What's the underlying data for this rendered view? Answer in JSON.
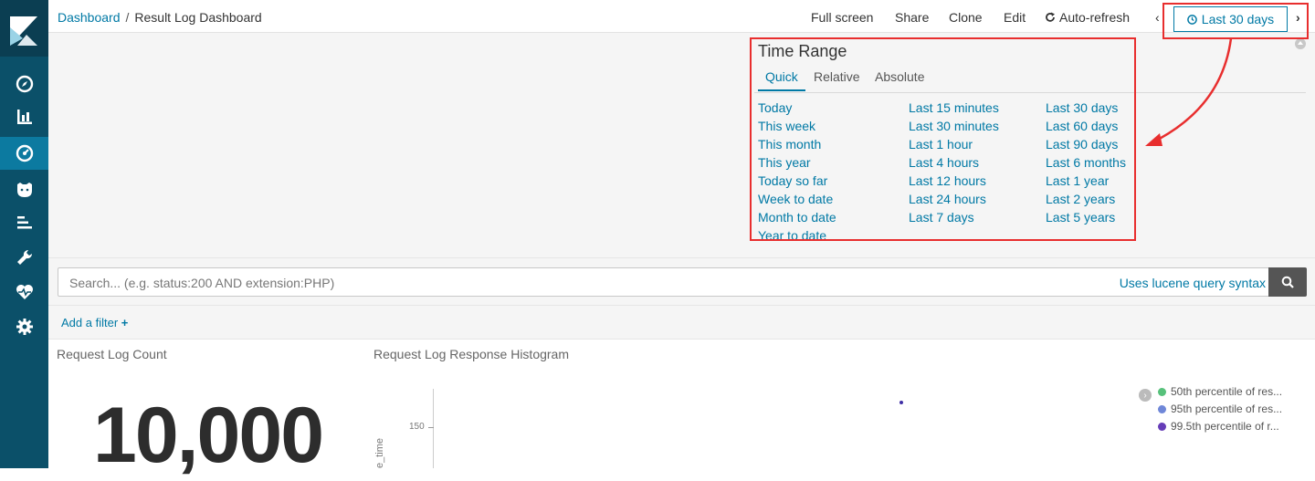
{
  "breadcrumb": {
    "root": "Dashboard",
    "separator": "/",
    "current": "Result Log Dashboard"
  },
  "topmenu": {
    "fullscreen": "Full screen",
    "share": "Share",
    "clone": "Clone",
    "edit": "Edit",
    "autorefresh": "Auto-refresh"
  },
  "timepicker": {
    "button_label": "Last 30 days",
    "prev": "‹",
    "next": "›"
  },
  "time_range": {
    "title": "Time Range",
    "tabs": [
      "Quick",
      "Relative",
      "Absolute"
    ],
    "columns": [
      [
        "Today",
        "This week",
        "This month",
        "This year",
        "Today so far",
        "Week to date",
        "Month to date",
        "Year to date"
      ],
      [
        "Last 15 minutes",
        "Last 30 minutes",
        "Last 1 hour",
        "Last 4 hours",
        "Last 12 hours",
        "Last 24 hours",
        "Last 7 days"
      ],
      [
        "Last 30 days",
        "Last 60 days",
        "Last 90 days",
        "Last 6 months",
        "Last 1 year",
        "Last 2 years",
        "Last 5 years"
      ]
    ]
  },
  "search": {
    "placeholder": "Search... (e.g. status:200 AND extension:PHP)",
    "syntax_link": "Uses lucene query syntax"
  },
  "filters": {
    "add_label": "Add a filter"
  },
  "panels": {
    "count": {
      "title": "Request Log Count",
      "value": "10,000"
    },
    "histogram": {
      "title": "Request Log Response Histogram",
      "y_tick": "150",
      "y_label": "e_time",
      "legend": [
        {
          "label": "50th percentile of res...",
          "color": "#57c17b"
        },
        {
          "label": "95th percentile of res...",
          "color": "#6f87d8"
        },
        {
          "label": "99.5th percentile of r...",
          "color": "#663db8"
        }
      ]
    }
  },
  "colors": {
    "accent": "#0079a5",
    "nav_bg": "#0b5069",
    "nav_active": "#0c7aa0",
    "annotation": "#e82e2e"
  }
}
